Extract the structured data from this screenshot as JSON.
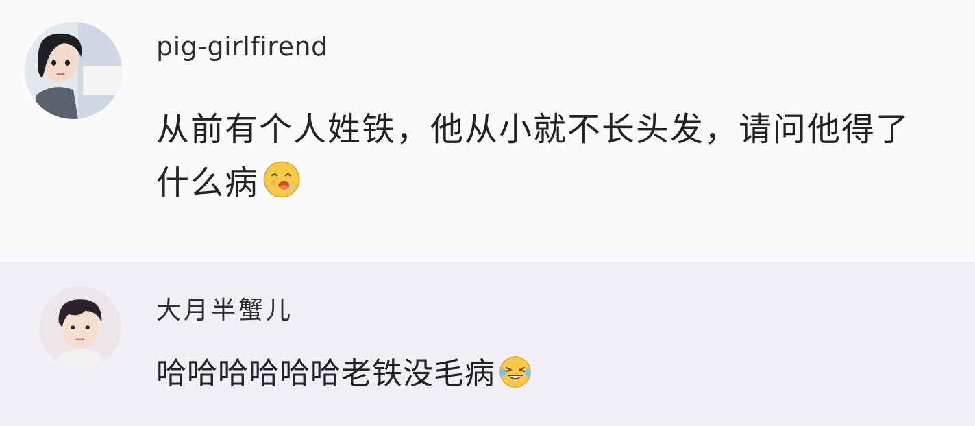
{
  "comments": [
    {
      "username": "pig-girlfirend",
      "text": "从前有个人姓铁，他从小就不长头发，请问他得了什么病",
      "emoji_icon": "drooling-face-icon",
      "avatar_icon": "anime-girl-avatar"
    },
    {
      "username": "大月半蟹儿",
      "text": "哈哈哈哈哈哈老铁没毛病",
      "emoji_icon": "laughing-tears-face-icon",
      "avatar_icon": "young-man-avatar"
    }
  ],
  "colors": {
    "background_top": "#faf9fb",
    "background_bottom": "#f1eff5",
    "text": "#222222",
    "emoji_yellow": "#f6c94a"
  }
}
